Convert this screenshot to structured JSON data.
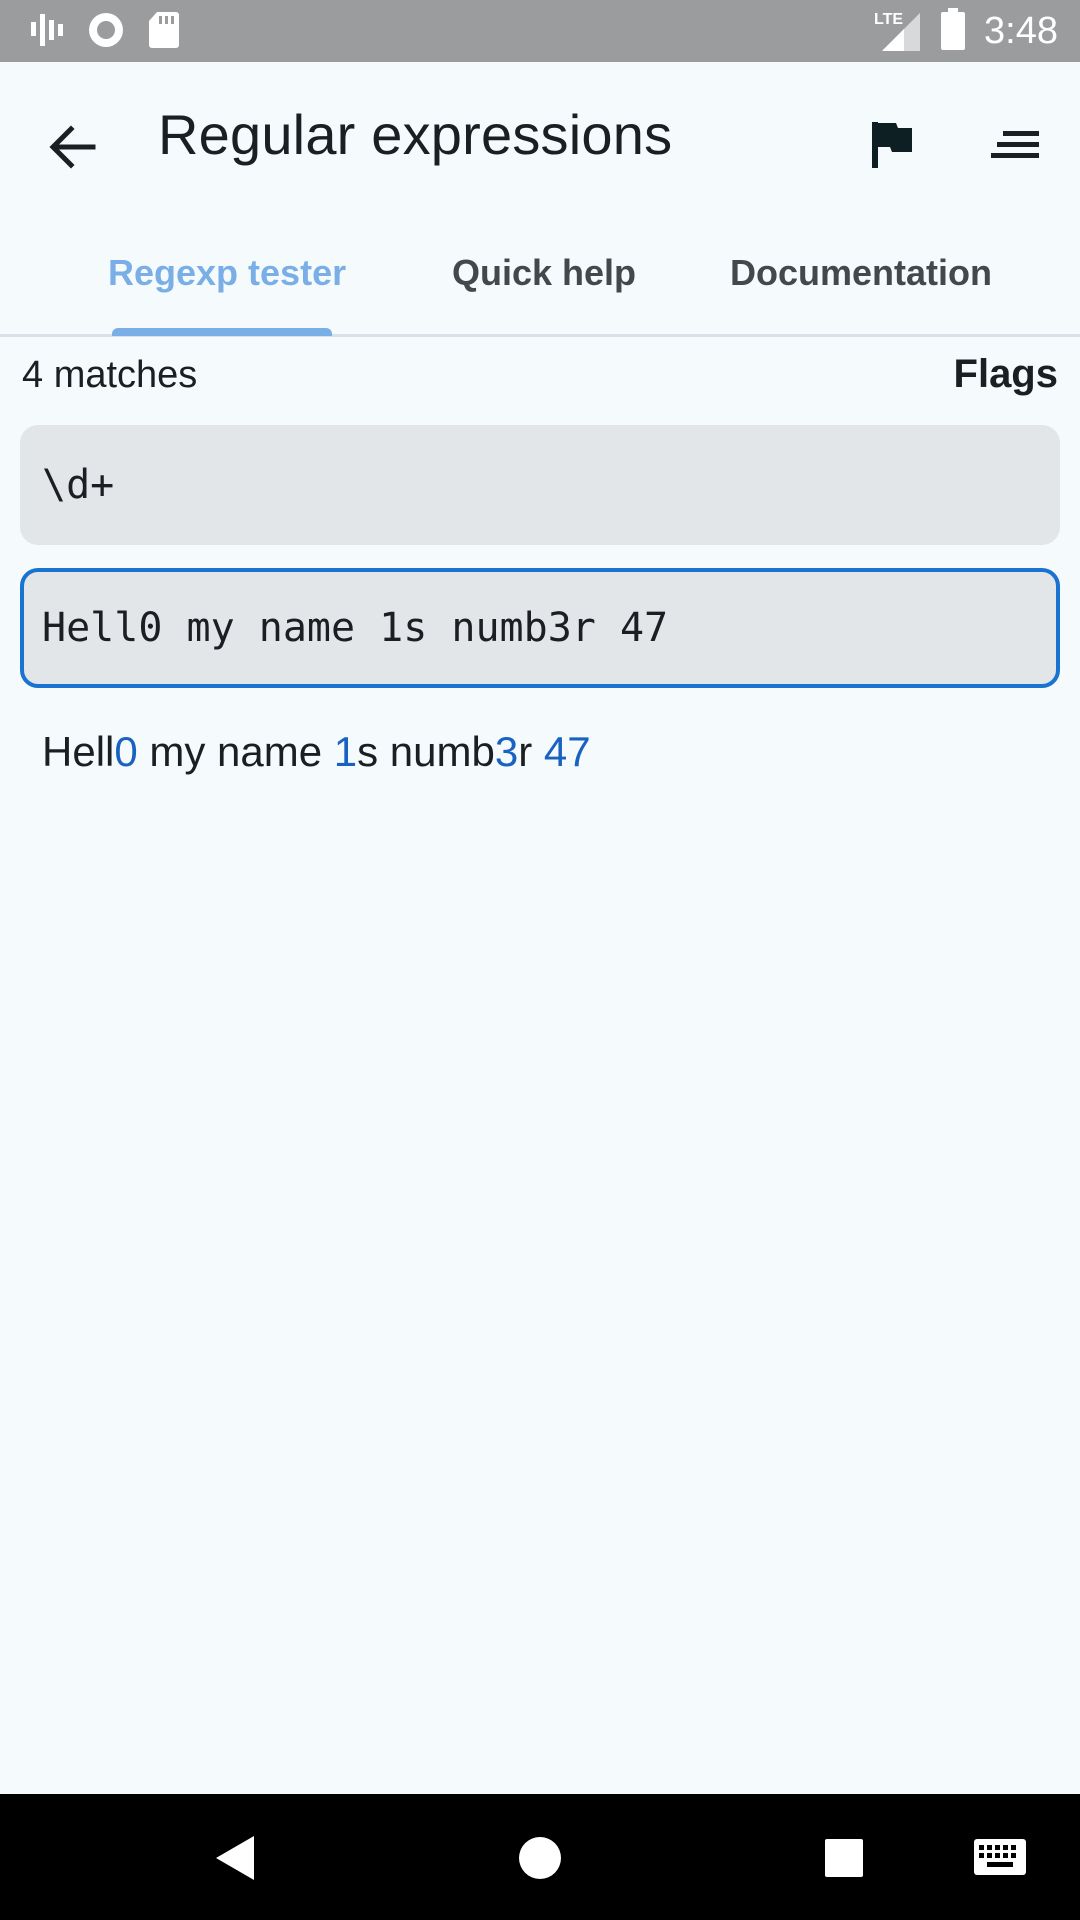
{
  "status_bar": {
    "time": "3:48",
    "network": "LTE",
    "icons": [
      "waveform-icon",
      "record-icon",
      "sd-card-icon",
      "signal-icon",
      "battery-icon"
    ]
  },
  "app_bar": {
    "title": "Regular expressions",
    "back_icon": "arrow-left-icon",
    "flag_icon": "flag-icon",
    "menu_icon": "menu-icon"
  },
  "tabs": [
    {
      "label": "Regexp tester",
      "active": true
    },
    {
      "label": "Quick help",
      "active": false
    },
    {
      "label": "Documentation",
      "active": false
    }
  ],
  "tester": {
    "match_count": "4 matches",
    "flags_label": "Flags",
    "regex_value": "\\d+",
    "test_value": "Hell0 my name 1s numb3r 47",
    "result_segments": [
      {
        "text": "Hell",
        "match": false
      },
      {
        "text": "0",
        "match": true
      },
      {
        "text": " my name ",
        "match": false
      },
      {
        "text": "1",
        "match": true
      },
      {
        "text": "s numb",
        "match": false
      },
      {
        "text": "3",
        "match": true
      },
      {
        "text": "r ",
        "match": false
      },
      {
        "text": "47",
        "match": true
      }
    ]
  },
  "colors": {
    "accent": "#1a73d0",
    "tab_active": "#7aaee6",
    "match": "#1a62c2",
    "background": "#f5fafd"
  },
  "nav_bar": {
    "icons": [
      "back-triangle-icon",
      "home-circle-icon",
      "recents-square-icon",
      "keyboard-icon"
    ]
  }
}
